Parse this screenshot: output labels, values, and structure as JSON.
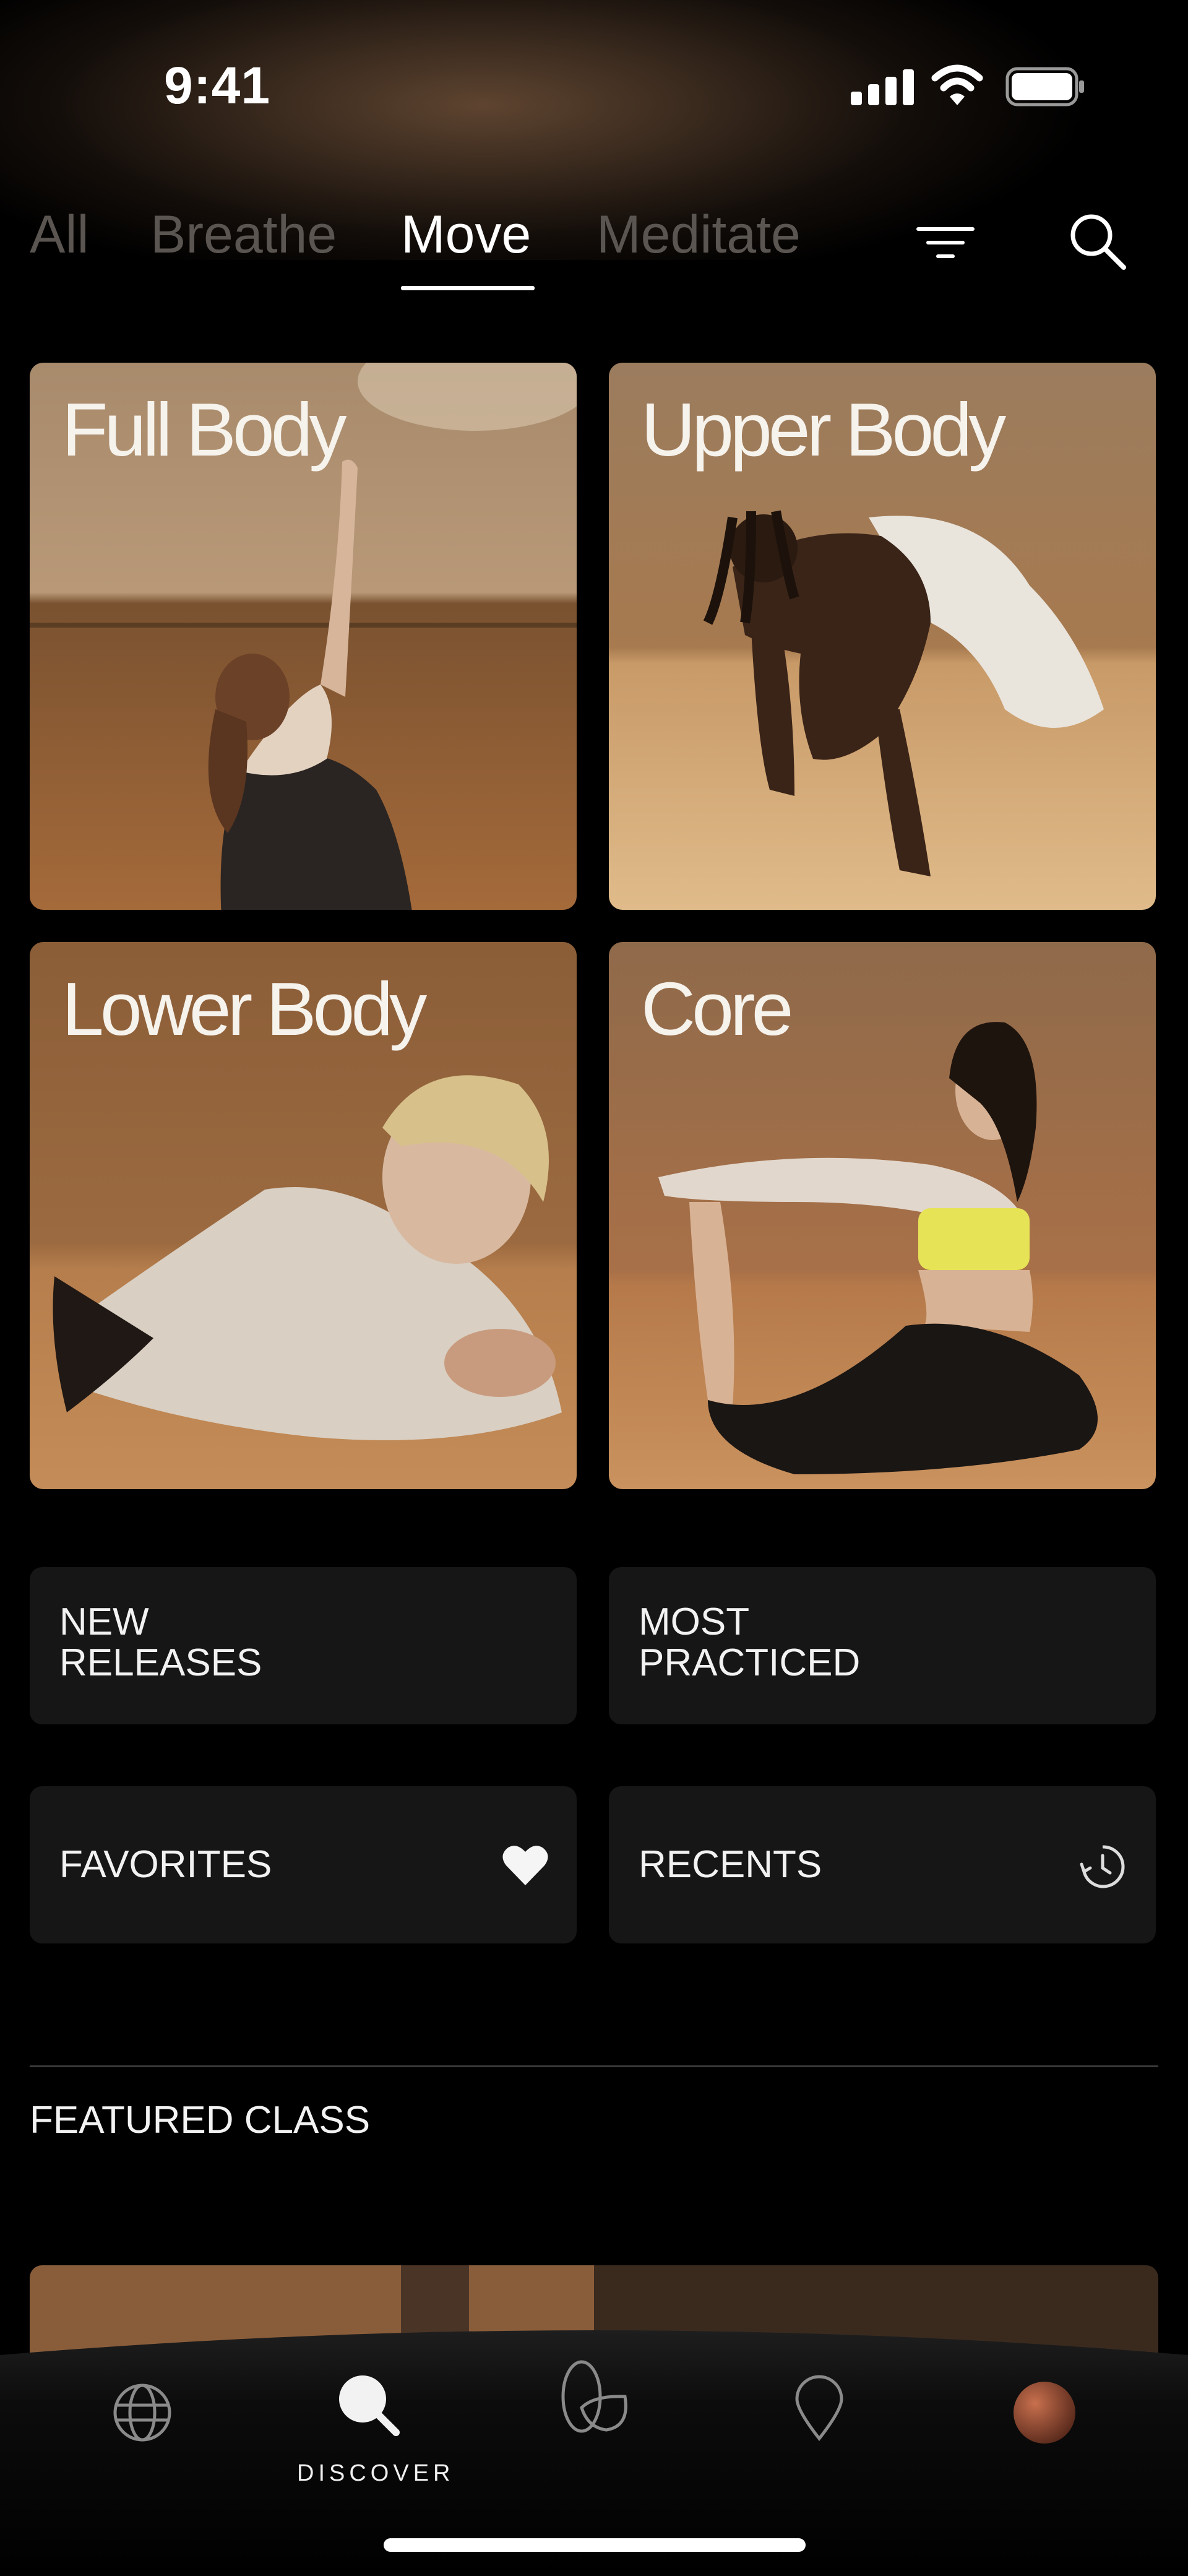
{
  "status_bar": {
    "time": "9:41",
    "signal_icon": "cellular-signal-icon",
    "wifi_icon": "wifi-icon",
    "battery_icon": "battery-icon"
  },
  "tabs": [
    {
      "label": "All",
      "active": false
    },
    {
      "label": "Breathe",
      "active": false
    },
    {
      "label": "Move",
      "active": true
    },
    {
      "label": "Meditate",
      "active": false
    }
  ],
  "header_icons": {
    "filter": "filter-lines-icon",
    "search": "search-icon"
  },
  "categories": [
    {
      "label": "Full Body"
    },
    {
      "label": "Upper Body"
    },
    {
      "label": "Lower Body"
    },
    {
      "label": "Core"
    }
  ],
  "shortcuts": [
    {
      "label": "NEW\nRELEASES",
      "icon": ""
    },
    {
      "label": "MOST\nPRACTICED",
      "icon": ""
    },
    {
      "label": "FAVORITES",
      "icon": "heart-icon"
    },
    {
      "label": "RECENTS",
      "icon": "history-clock-icon"
    }
  ],
  "featured": {
    "heading": "FEATURED CLASS"
  },
  "bottom_nav": {
    "items": [
      {
        "icon": "globe-icon",
        "active": false
      },
      {
        "icon": "search-icon",
        "active": true,
        "label": "DISCOVER"
      },
      {
        "icon": "body-icon",
        "active": false
      },
      {
        "icon": "location-pin-icon",
        "active": false
      },
      {
        "icon": "avatar",
        "active": false
      }
    ],
    "active_label": "DISCOVER"
  },
  "colors": {
    "background": "#000000",
    "card": "#161616",
    "inactive_tab": "#5a5550",
    "accent_wood": "#a06a3c"
  }
}
